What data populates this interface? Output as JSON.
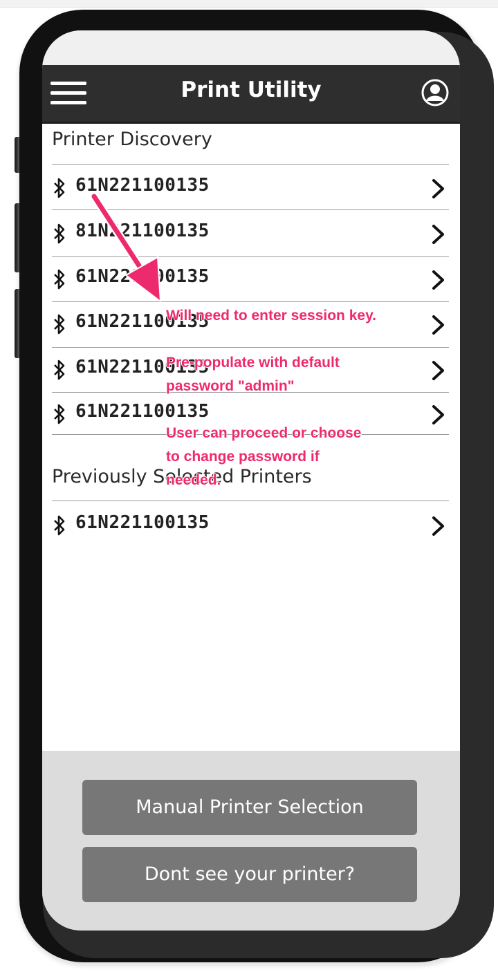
{
  "app": {
    "title": "Print Utility"
  },
  "header": {
    "menu_icon": "hamburger-menu-icon",
    "profile_icon": "user-profile-icon"
  },
  "discovery": {
    "title": "Printer Discovery",
    "printers": [
      {
        "name": "61N221100135"
      },
      {
        "name": "81N221100135"
      },
      {
        "name": "61N221100135"
      },
      {
        "name": "61N221100135"
      },
      {
        "name": "61N221100135"
      },
      {
        "name": "61N221100135"
      }
    ]
  },
  "previous": {
    "title": "Previously Selected Printers",
    "printers": [
      {
        "name": "61N221100135"
      }
    ]
  },
  "actions": {
    "manual": "Manual Printer Selection",
    "help": "Dont see your printer?"
  },
  "annotations": {
    "line1": "Will need to enter session key.",
    "line2a": "Pre-populate with default",
    "line2b": "password \"admin\"",
    "line3a": "User can proceed or choose",
    "line3b": "to change password if",
    "line3c": "needed."
  },
  "colors": {
    "annotation": "#ee2a6e",
    "appbar": "#2e2e2e",
    "button": "#777777"
  }
}
